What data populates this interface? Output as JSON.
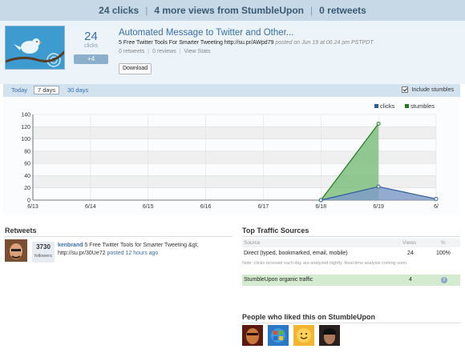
{
  "topbar": {
    "clicks": "24 clicks",
    "views": "4 more views from StumbleUpon",
    "retweets": "0 retweets"
  },
  "header": {
    "click_count": "24",
    "click_label": "clicks",
    "click_delta": "+4",
    "title": "Automated Message to Twitter and Other...",
    "description": "5 Free Twitter Tools For Smarter Tweeting http://su.pr/AWpd79",
    "posted": "posted on Jun 19 at 06.24 pm PSTPDT",
    "meta": [
      "0 retweets",
      "0 reviews",
      "View Stats"
    ],
    "download_label": "Download"
  },
  "tabs": {
    "items": [
      "Today",
      "7 days",
      "30 days"
    ],
    "active": "7 days",
    "include_label": "Include stumbles",
    "include_checked": true
  },
  "chart_data": {
    "type": "area",
    "x": [
      "6/13",
      "6/14",
      "6/15",
      "6/16",
      "6/17",
      "6/18",
      "6/19",
      "6/"
    ],
    "yticks": [
      0,
      20,
      40,
      60,
      80,
      100,
      120,
      140
    ],
    "ylim": [
      0,
      140
    ],
    "grid": true,
    "legend_position": "top-right",
    "series": [
      {
        "name": "clicks",
        "color": "#2e5c99",
        "values": [
          0,
          0,
          0,
          0,
          0,
          0,
          22,
          2
        ]
      },
      {
        "name": "stumbles",
        "color": "#1e7a1e",
        "values": [
          0,
          0,
          0,
          0,
          0,
          0,
          125,
          null
        ]
      }
    ]
  },
  "retweets": {
    "heading": "Retweets",
    "followers_count": "3730",
    "followers_label": "followers",
    "user": "kenbrand",
    "text_line1": "5 Free Twitter Tools for Smarter Tweeting &gt;",
    "text_line2": "http://su.pr/30Ue72",
    "when": "posted 12 hours ago"
  },
  "traffic": {
    "heading": "Top Traffic Sources",
    "col_source": "Source",
    "col_views": "Views",
    "col_pct": "%",
    "row_source": "Direct (typed, bookmarked, email, mobile)",
    "row_views": "24",
    "row_pct": "100%",
    "note": "Note: clicks received each day are analyzed nightly. Real-time analysis coming soon.",
    "stumble_source": "StumbleUpon organic traffic",
    "stumble_views": "4"
  },
  "likers": {
    "heading": "People who liked this on StumbleUpon"
  },
  "colors": {
    "accent": "#3a6ea5",
    "clicks": "#2e5c99",
    "stumbles": "#1e7a1e",
    "stumble_row": "#d5ebcf"
  }
}
